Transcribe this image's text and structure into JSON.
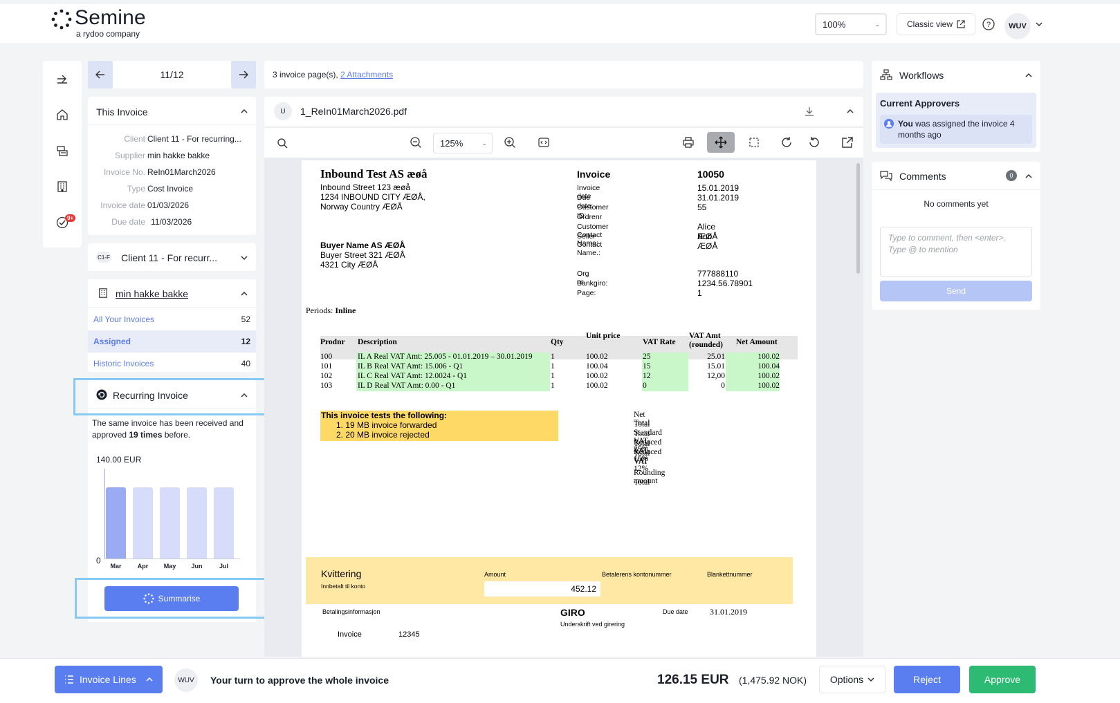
{
  "header": {
    "logo_title": "Semine",
    "logo_subtitle": "a rydoo company",
    "zoom_value": "100%",
    "classic_view_label": "Classic view",
    "user_initials": "WUV"
  },
  "rail": {
    "badge_count": "9+"
  },
  "pager": {
    "position": "11/12"
  },
  "this_invoice": {
    "title": "This Invoice",
    "fields": [
      {
        "key": "Client",
        "value": "Client 11 - For recurring..."
      },
      {
        "key": "Supplier",
        "value": "min hakke bakke"
      },
      {
        "key": "Invoice No.",
        "value": "ReIn01March2026"
      },
      {
        "key": "Type",
        "value": "Cost Invoice"
      },
      {
        "key": "Invoice date",
        "value": "01/03/2026"
      },
      {
        "key": "Due date",
        "value": "11/03/2026"
      }
    ]
  },
  "client_panel": {
    "tag": "C1-F",
    "title": "Client 11 - For recurr..."
  },
  "supplier_panel": {
    "title": "min hakke bakke",
    "rows": [
      {
        "label": "All Your Invoices",
        "count": "52"
      },
      {
        "label": "Assigned",
        "count": "12"
      },
      {
        "label": "Historic Invoices",
        "count": "40"
      }
    ]
  },
  "recurring": {
    "title": "Recurring Invoice",
    "text_before": "The same invoice has been received and approved ",
    "times": "19 times",
    "text_after": " before.",
    "summarise_label": "Summarise"
  },
  "chart_data": {
    "type": "bar",
    "title": "",
    "categories": [
      "Mar",
      "Apr",
      "May",
      "Jun",
      "Jul"
    ],
    "values": [
      126.15,
      126.15,
      126.15,
      126.15,
      126.15
    ],
    "ylim": [
      0,
      140
    ],
    "y_top_label": "140.00 EUR",
    "y_zero_label": "0",
    "colors": {
      "highlight": "#9aabf3",
      "normal": "#d6dcfa"
    }
  },
  "pages_bar": {
    "pages_text": "3 invoice page(s), ",
    "attachments_link": "2 Attachments"
  },
  "file_bar": {
    "uploader_initial": "U",
    "filename": "1_ReIn01March2026.pdf"
  },
  "viewer": {
    "zoom_value": "125%"
  },
  "document": {
    "seller_name": "Inbound Test AS æøå",
    "seller_addr1": "Inbound Street 123 æøå",
    "seller_addr2": "1234 INBOUND CITY ÆØÅ,",
    "seller_addr3": "Norway Country ÆØÅ",
    "invoice_label": "Invoice",
    "invoice_number": "10050",
    "meta": [
      {
        "k": "Invoice date",
        "v": "15.01.2019"
      },
      {
        "k": "Due date:",
        "v": "31.01.2019"
      },
      {
        "k": "Customer ID:",
        "v": "55"
      },
      {
        "k": "Ordrenr",
        "v": ""
      },
      {
        "k": "Customer Contact Name:",
        "v": "Alice ÆØÅ"
      },
      {
        "k": "Seller Contact Name.:",
        "v": "Bob ÆØÅ"
      }
    ],
    "buyer_name": "Buyer Name AS ÆØÅ",
    "buyer_addr1": "Buyer Street 321 ÆØÅ",
    "buyer_addr2": "4321 City ÆØÅ",
    "meta2": [
      {
        "k": "Org nr",
        "v": "777888110"
      },
      {
        "k": "Bankgiro:",
        "v": "1234.56.78901"
      },
      {
        "k": "Page:",
        "v": "1"
      }
    ],
    "periods_label": "Periods: ",
    "periods_value": "Inline",
    "table_headers": [
      "Prodnr",
      "Description",
      "Qty",
      "Unit price",
      "VAT Rate",
      "VAT Amt (rounded)",
      "Net Amount"
    ],
    "table_rows": [
      [
        "100",
        "IL A Real VAT Amt: 25.005   - 01.01.2019 – 30.01.2019",
        "1",
        "100.02",
        "25",
        "25.01",
        "100.02"
      ],
      [
        "101",
        "IL B Real VAT Amt: 15.006    - Q1",
        "1",
        "100.04",
        "15",
        "15.01",
        "100.04"
      ],
      [
        "102",
        "IL C Real VAT Amt: 12.0024    - Q1",
        "1",
        "100.02",
        "12",
        "12,00",
        "100.02"
      ],
      [
        "103",
        "IL D Real VAT Amt: 0.00    - Q1",
        "1",
        "100.02",
        "0",
        "0",
        "100.02"
      ]
    ],
    "tests_title": "This invoice tests the following:",
    "tests_items": [
      "1.    19 MB invoice forwarded",
      "2.    20 MB invoice rejected"
    ],
    "totals": [
      "Net Total",
      "Total Standard VAT 25%",
      "Total Reduced VAT 15%",
      "Total Reduced VAT 12%",
      "Total VAT",
      "",
      "Rounding amount",
      "Total"
    ],
    "kvittering": "Kvittering",
    "innbetalt": "Innbetalt til konto",
    "amount_label": "Amount",
    "amount_value": "452.12",
    "betalerens": "Betalerens kontonummer",
    "blankett": "Blankettnummer",
    "betalingsinfo": "Betalingsinformasjon",
    "giro": "GIRO",
    "underskrift": "Underskrift ved girering",
    "due_date_label": "Due date",
    "due_date_value": "31.01.2019",
    "footer_invoice_label": "Invoice",
    "footer_invoice_value": "12345"
  },
  "workflows": {
    "title": "Workflows",
    "approvers_title": "Current Approvers",
    "you": "You",
    "assigned_text": " was assigned the invoice 4 months ago"
  },
  "comments": {
    "title": "Comments",
    "count": "0",
    "empty": "No comments yet",
    "placeholder": "Type to comment, then <enter>. Type @ to mention",
    "send_label": "Send"
  },
  "bottom": {
    "invoice_lines_label": "Invoice Lines",
    "user_initials": "WUV",
    "turn_text": "Your turn to approve the whole invoice",
    "amount": "126.15 EUR",
    "amount_nok": "(1,475.92 NOK)",
    "options_label": "Options",
    "reject_label": "Reject",
    "approve_label": "Approve"
  }
}
